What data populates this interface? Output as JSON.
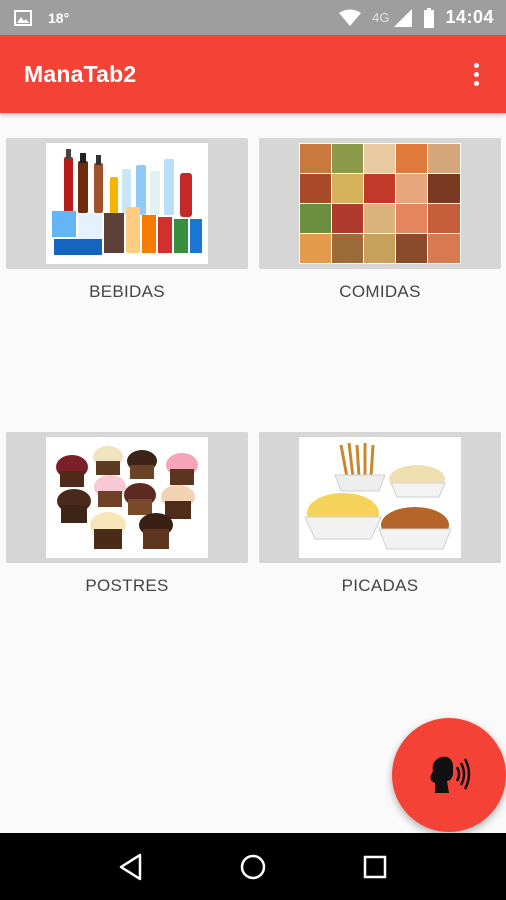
{
  "status_bar": {
    "temperature": "18°",
    "network": "4G",
    "time": "14:04"
  },
  "app_bar": {
    "title": "ManaTab2"
  },
  "categories": [
    {
      "label": "BEBIDAS",
      "image": "drinks"
    },
    {
      "label": "COMIDAS",
      "image": "meals"
    },
    {
      "label": "POSTRES",
      "image": "cupcakes"
    },
    {
      "label": "PICADAS",
      "image": "snacks"
    }
  ],
  "fab": {
    "icon": "speaking-head-icon"
  },
  "nav": {
    "back": "back-icon",
    "home": "home-icon",
    "recents": "recents-icon"
  },
  "colors": {
    "primary": "#f44336",
    "status_bar": "#9e9e9e",
    "tile_bg": "#d6d6d6"
  }
}
